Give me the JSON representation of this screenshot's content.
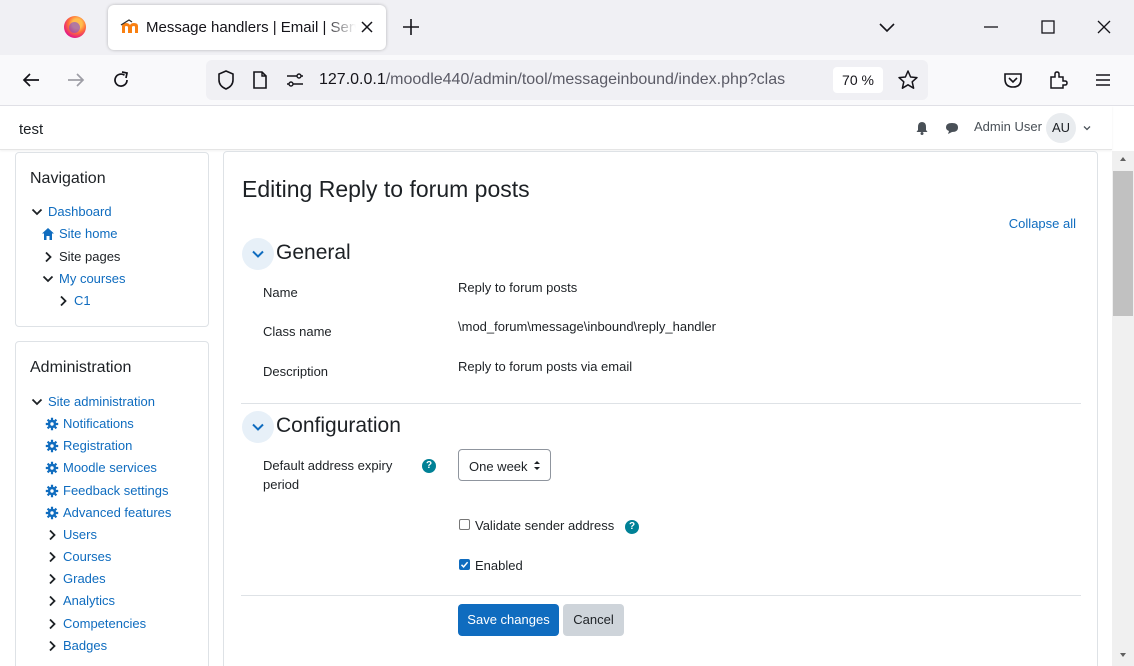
{
  "browser": {
    "tab_title": "Message handlers | Email | Serv",
    "url_host": "127.0.0.1",
    "url_path": "/moodle440/admin/tool/messageinbound/index.php?clas",
    "zoom": "70 %"
  },
  "header": {
    "site_name": "test",
    "user_name": "Admin User",
    "avatar_initials": "AU"
  },
  "navigation": {
    "title": "Navigation",
    "items": [
      {
        "label": "Dashboard"
      },
      {
        "label": "Site home"
      },
      {
        "label": "Site pages"
      },
      {
        "label": "My courses"
      },
      {
        "label": "C1"
      }
    ]
  },
  "administration": {
    "title": "Administration",
    "items": [
      {
        "label": "Site administration"
      },
      {
        "label": "Notifications"
      },
      {
        "label": "Registration"
      },
      {
        "label": "Moodle services"
      },
      {
        "label": "Feedback settings"
      },
      {
        "label": "Advanced features"
      },
      {
        "label": "Users"
      },
      {
        "label": "Courses"
      },
      {
        "label": "Grades"
      },
      {
        "label": "Analytics"
      },
      {
        "label": "Competencies"
      },
      {
        "label": "Badges"
      }
    ]
  },
  "main": {
    "page_title": "Editing Reply to forum posts",
    "collapse_all": "Collapse all",
    "general": {
      "title": "General",
      "name_label": "Name",
      "name_value": "Reply to forum posts",
      "class_label": "Class name",
      "class_value": "\\mod_forum\\message\\inbound\\reply_handler",
      "desc_label": "Description",
      "desc_value": "Reply to forum posts via email"
    },
    "configuration": {
      "title": "Configuration",
      "expiry_label_line1": "Default address expiry",
      "expiry_label_line2": "period",
      "expiry_value": "One week",
      "validate_label": "Validate sender address",
      "validate_checked": false,
      "enabled_label": "Enabled",
      "enabled_checked": true
    },
    "help_glyph": "?",
    "save_label": "Save changes",
    "cancel_label": "Cancel"
  },
  "colors": {
    "link": "#0f6cbf",
    "primary": "#0f6cbf",
    "help": "#008196"
  }
}
